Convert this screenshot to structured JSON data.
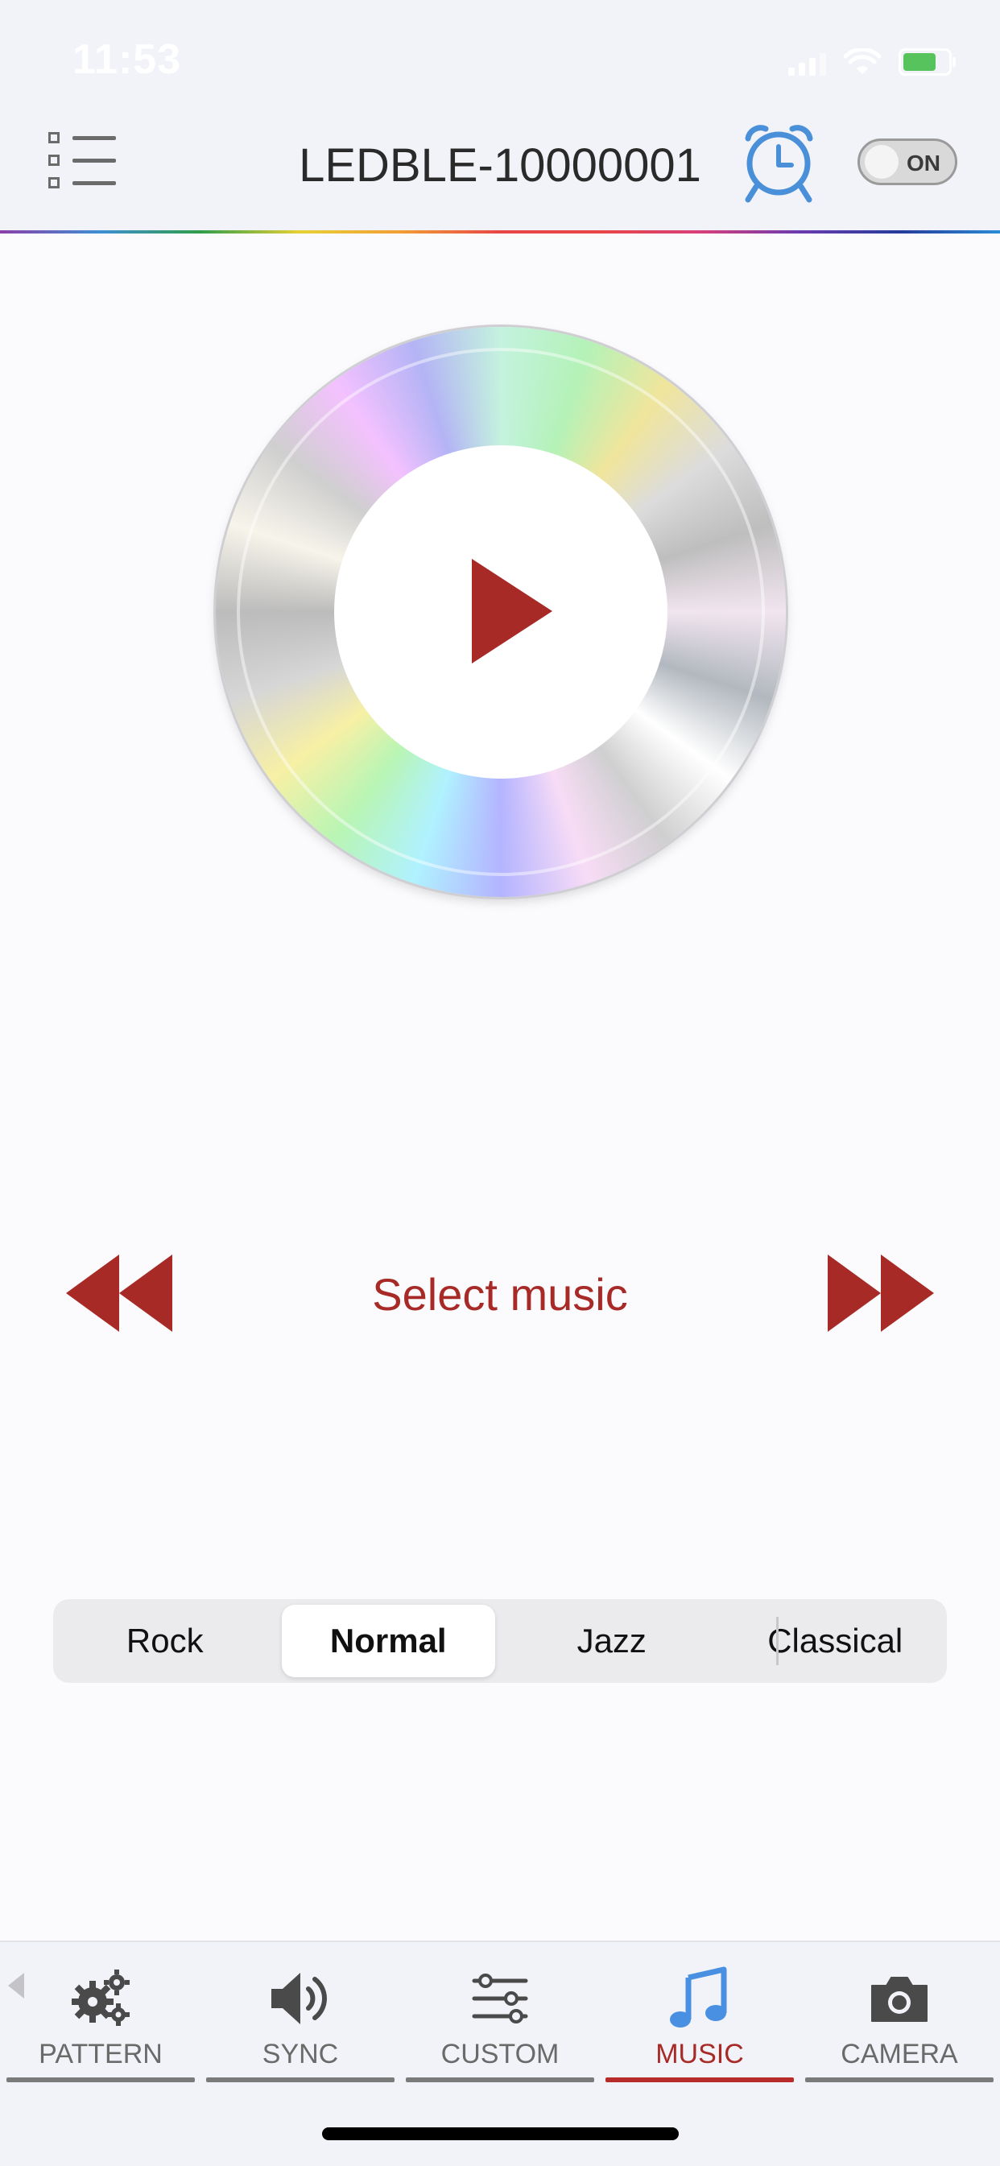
{
  "status_bar": {
    "time": "11:53"
  },
  "header": {
    "title": "LEDBLE-10000001",
    "toggle_label": "ON"
  },
  "player": {
    "select_music_label": "Select music"
  },
  "genres": {
    "options": [
      "Rock",
      "Normal",
      "Jazz",
      "Classical"
    ],
    "selected": "Normal"
  },
  "tabs": [
    {
      "label": "PATTERN",
      "icon": "gears-icon"
    },
    {
      "label": "SYNC",
      "icon": "speaker-icon"
    },
    {
      "label": "CUSTOM",
      "icon": "sliders-icon"
    },
    {
      "label": "MUSIC",
      "icon": "music-note-icon",
      "active": true
    },
    {
      "label": "CAMERA",
      "icon": "camera-icon"
    }
  ],
  "colors": {
    "accent_red": "#a82a26",
    "alarm_blue": "#4a90d9",
    "active_music_blue": "#4a90e2"
  }
}
